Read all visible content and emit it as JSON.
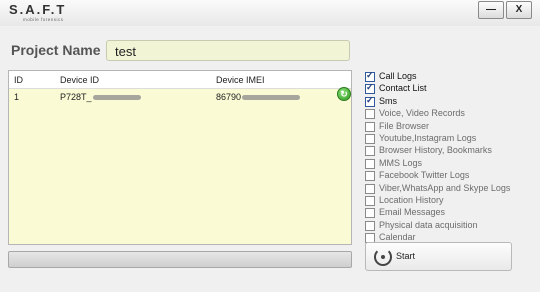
{
  "app": {
    "logo": "S.A.F.T",
    "logo_sub": "mobile forensics",
    "min_label": "—",
    "close_label": "X"
  },
  "project": {
    "label": "Project Name",
    "value": "test"
  },
  "table": {
    "headers": [
      "ID",
      "Device ID",
      "Device IMEI"
    ],
    "rows": [
      {
        "id": "1",
        "device_id": "P728T_",
        "device_imei": "86790"
      }
    ]
  },
  "options": [
    {
      "label": "Call Logs",
      "checked": true
    },
    {
      "label": "Contact List",
      "checked": true
    },
    {
      "label": "Sms",
      "checked": true
    },
    {
      "label": "Voice, Video Records",
      "checked": false
    },
    {
      "label": "File Browser",
      "checked": false
    },
    {
      "label": "Youtube,Instagram Logs",
      "checked": false
    },
    {
      "label": "Browser History, Bookmarks",
      "checked": false
    },
    {
      "label": "MMS Logs",
      "checked": false
    },
    {
      "label": "Facebook  Twitter Logs",
      "checked": false
    },
    {
      "label": "Viber,WhatsApp and Skype Logs",
      "checked": false
    },
    {
      "label": "Location History",
      "checked": false
    },
    {
      "label": "Email Messages",
      "checked": false
    },
    {
      "label": "Physical data acquisition",
      "checked": false
    },
    {
      "label": "Calendar",
      "checked": false
    }
  ],
  "start": {
    "label": "Start"
  },
  "progress": {
    "value": 0
  }
}
